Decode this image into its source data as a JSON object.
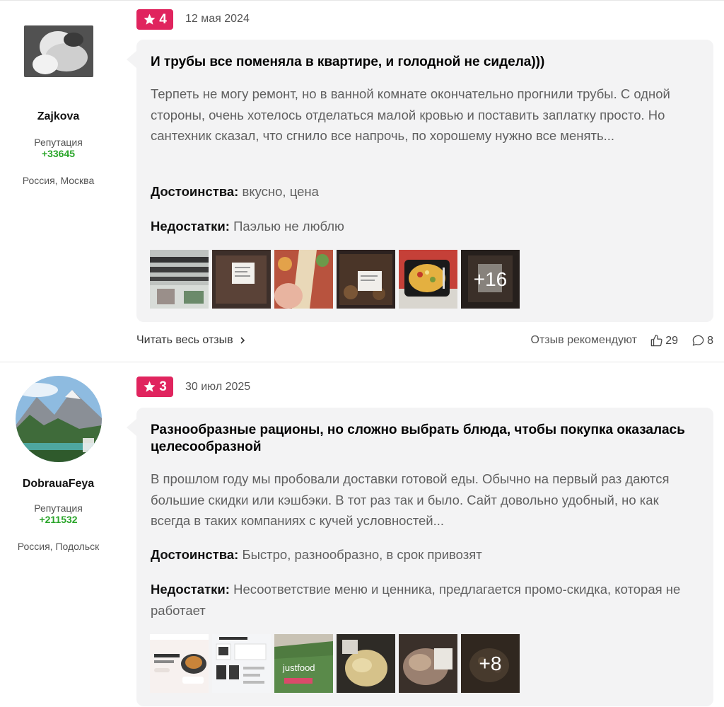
{
  "reviews": [
    {
      "author": {
        "name": "Zajkova",
        "reputation_label": "Репутация",
        "reputation_value": "+33645",
        "location": "Россия, Москва"
      },
      "rating": "4",
      "date": "12 мая 2024",
      "title": "И трубы все поменяла в квартире, и голодной не сидела)))",
      "text": "Терпеть не могу ремонт, но в ванной комнате окончательно прогнили трубы. С одной стороны, очень хотелось отделаться малой кровью и поставить заплатку просто. Но сантехник сказал, что сгнило все напрочь, по хорошему нужно все менять...",
      "pros_label": "Достоинства:",
      "pros": "вкусно, цена",
      "cons_label": "Недостатки:",
      "cons": "Паэлью не люблю",
      "more_photos": "+16",
      "read_more": "Читать весь отзыв",
      "recommend_label": "Отзыв рекомендуют",
      "likes": "29",
      "comments": "8"
    },
    {
      "author": {
        "name": "DobrauaFeya",
        "reputation_label": "Репутация",
        "reputation_value": "+211532",
        "location": "Россия, Подольск"
      },
      "rating": "3",
      "date": "30 июл 2025",
      "title": "Разнообразные рационы, но сложно выбрать блюда, чтобы покупка оказалась целесообразной",
      "text": "В прошлом году мы пробовали доставки готовой еды. Обычно на первый раз даются большие скидки или кэшбэки. В тот раз так и было. Сайт довольно удобный, но как всегда в таких компаниях с кучей условностей...",
      "pros_label": "Достоинства:",
      "pros": "Быстро, разнообразно, в срок привозят",
      "cons_label": "Недостатки:",
      "cons": "Несоответствие меню и ценника, предлагается промо-скидка, которая не работает",
      "more_photos": "+8"
    }
  ],
  "colors": {
    "badge": "#e0245e",
    "reputation": "#2aa52a",
    "card_bg": "#f3f3f4"
  },
  "icons": [
    "star-icon",
    "chevron-right-icon",
    "thumbs-up-icon",
    "comment-icon"
  ]
}
